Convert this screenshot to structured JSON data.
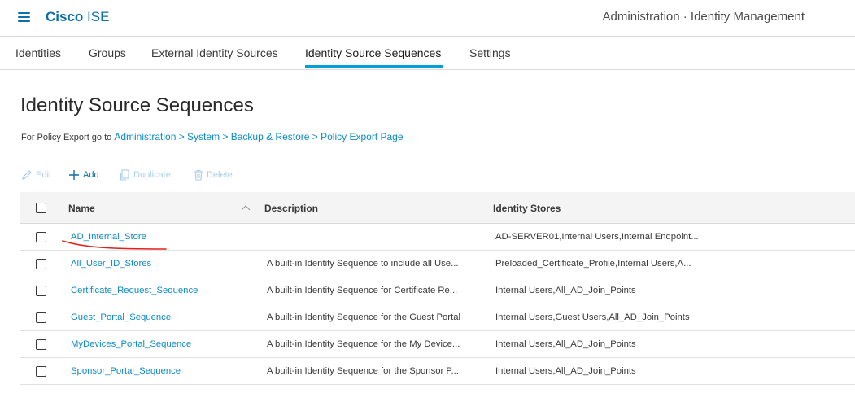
{
  "header": {
    "brand_bold": "Cisco",
    "brand_rest": "ISE",
    "title": "Administration · Identity Management"
  },
  "tabs": [
    {
      "label": "Identities",
      "active": false
    },
    {
      "label": "Groups",
      "active": false
    },
    {
      "label": "External Identity Sources",
      "active": false
    },
    {
      "label": "Identity Source Sequences",
      "active": true
    },
    {
      "label": "Settings",
      "active": false
    }
  ],
  "page": {
    "title": "Identity Source Sequences",
    "export_prefix": "For Policy Export go to",
    "export_link": "Administration > System > Backup & Restore > Policy Export Page"
  },
  "toolbar": {
    "edit": "Edit",
    "add": "Add",
    "duplicate": "Duplicate",
    "delete": "Delete"
  },
  "table": {
    "columns": {
      "name": "Name",
      "description": "Description",
      "stores": "Identity Stores"
    },
    "rows": [
      {
        "name": "AD_Internal_Store",
        "description": "",
        "stores": "AD-SERVER01,Internal Users,Internal Endpoint..."
      },
      {
        "name": "All_User_ID_Stores",
        "description": "A built-in Identity Sequence to include all Use...",
        "stores": "Preloaded_Certificate_Profile,Internal Users,A..."
      },
      {
        "name": "Certificate_Request_Sequence",
        "description": "A built-in Identity Sequence for Certificate Re...",
        "stores": "Internal Users,All_AD_Join_Points"
      },
      {
        "name": "Guest_Portal_Sequence",
        "description": "A built-in Identity Sequence for the Guest Portal",
        "stores": "Internal Users,Guest Users,All_AD_Join_Points"
      },
      {
        "name": "MyDevices_Portal_Sequence",
        "description": "A built-in Identity Sequence for the My Device...",
        "stores": "Internal Users,All_AD_Join_Points"
      },
      {
        "name": "Sponsor_Portal_Sequence",
        "description": "A built-in Identity Sequence for the Sponsor P...",
        "stores": "Internal Users,All_AD_Join_Points"
      }
    ]
  },
  "colors": {
    "accent": "#049fd9",
    "link": "#0d8ac3",
    "brand": "#0d6ea8",
    "annotation": "#e0201b"
  }
}
